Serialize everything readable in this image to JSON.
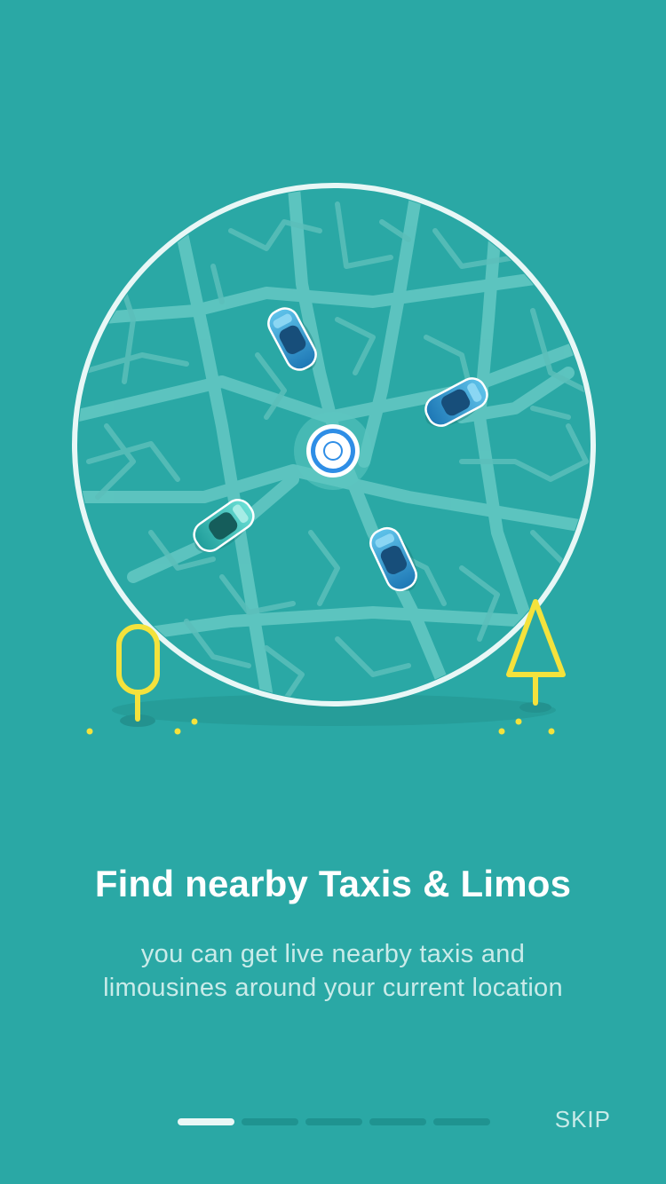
{
  "onboarding": {
    "title": "Find nearby Taxis & Limos",
    "description": "you can get live nearby taxis and limousines around your current location",
    "skip_label": "SKIP",
    "page_indicator": {
      "current": 1,
      "total": 5
    }
  },
  "illustration": {
    "icons": [
      "map-circle",
      "user-location-icon",
      "taxi-car-icon",
      "tree-icon"
    ]
  },
  "colors": {
    "background": "#2aa8a5",
    "accent_yellow": "#f4e23c",
    "location_blue": "#2f8ee6",
    "text_primary": "#ffffff",
    "text_secondary": "#c9ebe9"
  }
}
